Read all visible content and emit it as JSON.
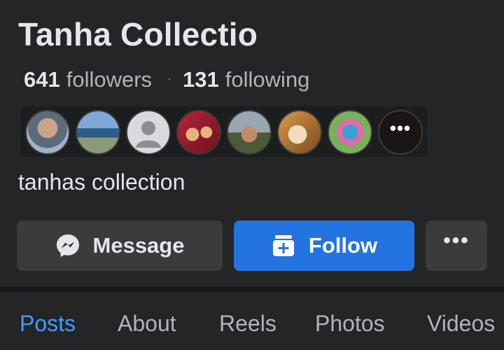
{
  "profile": {
    "name": "Tanha Collectio",
    "followers_count": "641",
    "followers_label": "followers",
    "separator": "·",
    "following_count": "131",
    "following_label": "following",
    "bio": "tanhas collection"
  },
  "follower_avatars": {
    "more_label": "•••"
  },
  "actions": {
    "message_label": "Message",
    "follow_label": "Follow",
    "more_label": "•••"
  },
  "tabs": [
    {
      "label": "Posts",
      "active": true
    },
    {
      "label": "About",
      "active": false
    },
    {
      "label": "Reels",
      "active": false
    },
    {
      "label": "Photos",
      "active": false
    },
    {
      "label": "Videos",
      "active": false
    }
  ],
  "colors": {
    "background": "#242526",
    "primary_blue": "#2374e1",
    "active_tab": "#4599ff",
    "secondary_button": "#3a3b3c"
  }
}
